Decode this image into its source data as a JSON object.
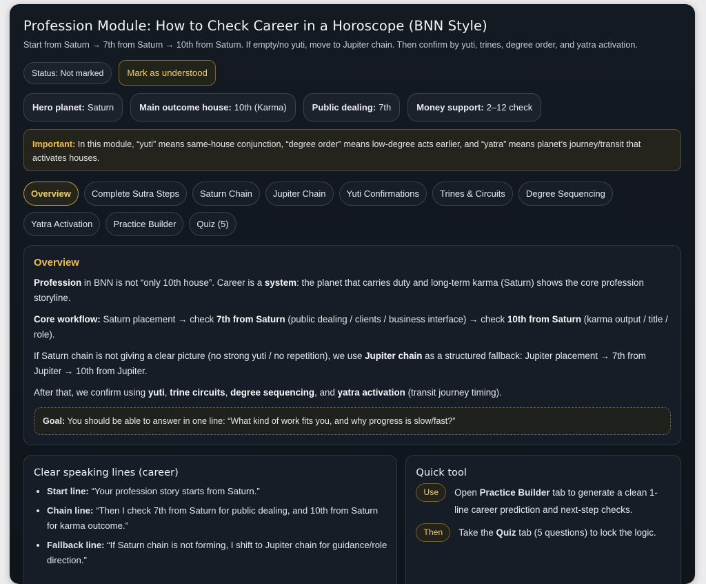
{
  "header": {
    "title": "Profession Module: How to Check Career in a Horoscope (BNN Style)",
    "subtitle": "Start from Saturn → 7th from Saturn → 10th from Saturn. If empty/no yuti, move to Jupiter chain. Then confirm by yuti, trines, degree order, and yatra activation."
  },
  "status": {
    "label": "Status: Not marked",
    "mark_button": "Mark as understood"
  },
  "facts": [
    {
      "key": "Hero planet:",
      "value": "Saturn"
    },
    {
      "key": "Main outcome house:",
      "value": "10th (Karma)"
    },
    {
      "key": "Public dealing:",
      "value": "7th"
    },
    {
      "key": "Money support:",
      "value": "2–12 check"
    }
  ],
  "important": {
    "label": "Important:",
    "text": " In this module, “yuti” means same-house conjunction, “degree order” means low-degree acts earlier, and “yatra” means planet’s journey/transit that activates houses."
  },
  "tabs": [
    {
      "label": "Overview",
      "active": true
    },
    {
      "label": "Complete Sutra Steps"
    },
    {
      "label": "Saturn Chain"
    },
    {
      "label": "Jupiter Chain"
    },
    {
      "label": "Yuti Confirmations"
    },
    {
      "label": "Trines & Circuits"
    },
    {
      "label": "Degree Sequencing"
    },
    {
      "label": "Yatra Activation"
    },
    {
      "label": "Practice Builder"
    },
    {
      "label": "Quiz (5)"
    }
  ],
  "overview": {
    "title": "Overview",
    "p1": {
      "b1": "Profession",
      "t1": " in BNN is not “only 10th house”. Career is a ",
      "b2": "system",
      "t2": ": the planet that carries duty and long-term karma (Saturn) shows the core profession storyline."
    },
    "p2": {
      "b1": "Core workflow:",
      "t1": " Saturn placement → check ",
      "b2": "7th from Saturn",
      "t2": " (public dealing / clients / business interface) → check ",
      "b3": "10th from Saturn",
      "t3": " (karma output / title / role)."
    },
    "p3": {
      "t1": "If Saturn chain is not giving a clear picture (no strong yuti / no repetition), we use ",
      "b1": "Jupiter chain",
      "t2": " as a structured fallback: Jupiter placement → 7th from Jupiter → 10th from Jupiter."
    },
    "p4": {
      "t1": "After that, we confirm using ",
      "b1": "yuti",
      "t2": ", ",
      "b2": "trine circuits",
      "t3": ", ",
      "b3": "degree sequencing",
      "t4": ", and ",
      "b4": "yatra activation",
      "t5": " (transit journey timing)."
    },
    "goal": {
      "label": "Goal:",
      "text": " You should be able to answer in one line: “What kind of work fits you, and why progress is slow/fast?”"
    }
  },
  "speaking": {
    "title": "Clear speaking lines (career)",
    "items": [
      {
        "label": "Start line:",
        "text": " “Your profession story starts from Saturn.”"
      },
      {
        "label": "Chain line:",
        "text": " “Then I check 7th from Saturn for public dealing, and 10th from Saturn for karma outcome.”"
      },
      {
        "label": "Fallback line:",
        "text": " “If Saturn chain is not forming, I shift to Jupiter chain for guidance/role direction.”"
      }
    ]
  },
  "quick_tool": {
    "title": "Quick tool",
    "rows": [
      {
        "badge": "Use",
        "t1": "Open ",
        "b1": "Practice Builder",
        "t2": " tab to generate a clean 1-line career prediction and next-step checks."
      },
      {
        "badge": "Then",
        "t1": "Take the ",
        "b1": "Quiz",
        "t2": " tab (5 questions) to lock the logic."
      }
    ]
  }
}
